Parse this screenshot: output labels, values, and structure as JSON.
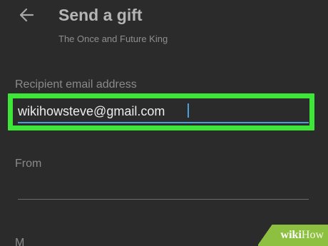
{
  "header": {
    "title": "Send a gift",
    "subtitle": "The Once and Future King",
    "back_icon": "arrow-left-icon"
  },
  "form": {
    "recipient_label": "Recipient email address",
    "recipient_value": "wikihowsteve@gmail.com",
    "from_label": "From",
    "from_value": "",
    "next_field_label_partial": "M"
  },
  "watermark": {
    "prefix": "wiki",
    "suffix": "How"
  },
  "colors": {
    "background": "#2b2b2b",
    "highlight": "#3fe63a",
    "focus_underline": "#4c9fd8",
    "watermark": "#8dc040"
  }
}
